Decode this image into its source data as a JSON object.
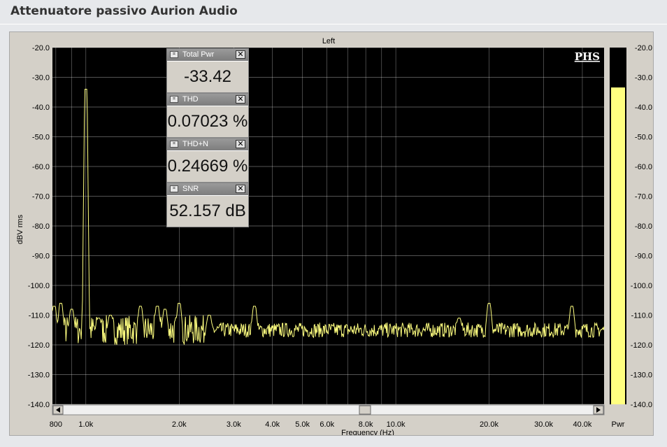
{
  "page": {
    "title": "Attenuatore passivo Aurion Audio"
  },
  "plot": {
    "channel_label": "Left",
    "ylabel": "dBV rms",
    "xlabel": "Frequency (Hz)",
    "logo": "PHS",
    "meter_label": "Pwr",
    "meter_level_dbv": -33.42
  },
  "meters": [
    {
      "label": "Total Pwr",
      "value": "-33.42 dBV rms",
      "icon": "meter-icon"
    },
    {
      "label": "THD",
      "value": "0.07023 %",
      "icon": "meter-icon"
    },
    {
      "label": "THD+N",
      "value": "0.24669 %",
      "icon": "meter-icon"
    },
    {
      "label": "SNR",
      "value": "52.157 dB",
      "icon": "meter-icon"
    }
  ],
  "colors": {
    "plot_bg": "#000000",
    "trace": "#ffff80",
    "meter_fill": "#ffff80",
    "grid": "#ffffff"
  },
  "chart_data": {
    "type": "line",
    "title": "Left",
    "xlabel": "Frequency (Hz)",
    "ylabel": "dBV rms",
    "xscale": "log",
    "xlim": [
      780,
      47000
    ],
    "ylim": [
      -140,
      -20
    ],
    "grid": true,
    "x_ticks": [
      "800",
      "1.0k",
      "2.0k",
      "3.0k",
      "4.0k",
      "5.0k",
      "6.0k",
      "8.0k",
      "10.0k",
      "20.0k",
      "30.0k",
      "40.0k"
    ],
    "x_tick_values": [
      800,
      1000,
      2000,
      3000,
      4000,
      5000,
      6000,
      8000,
      10000,
      20000,
      30000,
      40000
    ],
    "y_ticks": [
      "-20.0",
      "-30.0",
      "-40.0",
      "-50.0",
      "-60.0",
      "-70.0",
      "-80.0",
      "-90.0",
      "-100.0",
      "-110.0",
      "-120.0",
      "-130.0",
      "-140.0"
    ],
    "y_tick_values": [
      -20,
      -30,
      -40,
      -50,
      -60,
      -70,
      -80,
      -90,
      -100,
      -110,
      -120,
      -130,
      -140
    ],
    "noise_floor_dbv": -115,
    "peaks": [
      {
        "x": 790,
        "y": -107
      },
      {
        "x": 830,
        "y": -106
      },
      {
        "x": 900,
        "y": -108
      },
      {
        "x": 1000,
        "y": -34
      },
      {
        "x": 1100,
        "y": -111
      },
      {
        "x": 1200,
        "y": -110
      },
      {
        "x": 1500,
        "y": -107
      },
      {
        "x": 1700,
        "y": -107
      },
      {
        "x": 1800,
        "y": -108
      },
      {
        "x": 2000,
        "y": -106
      },
      {
        "x": 2500,
        "y": -110
      },
      {
        "x": 3500,
        "y": -107
      },
      {
        "x": 16000,
        "y": -111
      },
      {
        "x": 20000,
        "y": -106
      },
      {
        "x": 37000,
        "y": -107
      }
    ]
  }
}
